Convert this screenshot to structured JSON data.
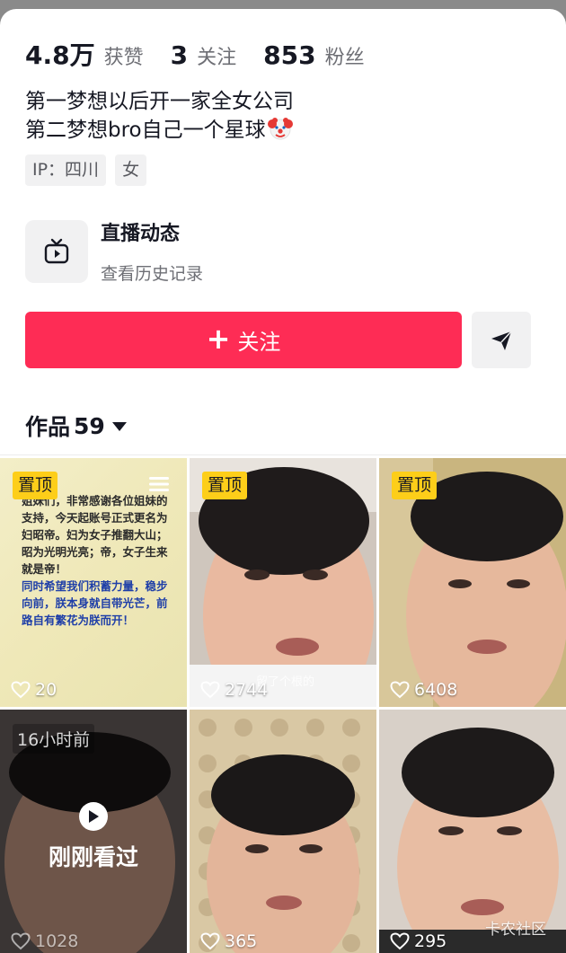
{
  "stats": [
    {
      "value": "4.8万",
      "label": "获赞"
    },
    {
      "value": "3",
      "label": "关注"
    },
    {
      "value": "853",
      "label": "粉丝"
    }
  ],
  "bio": {
    "line1": "第一梦想以后开一家全女公司",
    "line2": "第二梦想bro自己一个星球",
    "emoji_icon": "clown-face-icon"
  },
  "tags": [
    "IP：四川",
    "女"
  ],
  "live": {
    "icon": "tv-icon",
    "title": "直播动态",
    "subtitle": "查看历史记录"
  },
  "actions": {
    "follow_label": "关注",
    "follow_color": "#fe2c55",
    "share_icon": "send-icon"
  },
  "works": {
    "label": "作品",
    "count": "59"
  },
  "grid": {
    "pin_label": "置顶",
    "items": [
      {
        "likes": "20",
        "pinned": true,
        "doc_lines": [
          "姐妹们，非常感谢各位姐妹的支持，今天起账号正式更名为妇昭帝。妇为女子推翻大山；昭为光明光亮；帝，女子生来就是帝！",
          "同时希望我们积蓄力量，稳步向前，朕本身就自带光芒，前路自有繁花为朕而开！"
        ]
      },
      {
        "likes": "2744",
        "pinned": true,
        "caption": "留了个根的"
      },
      {
        "likes": "6408",
        "pinned": true
      },
      {
        "likes": "1028",
        "time": "16小时前",
        "watched": "刚刚看过"
      },
      {
        "likes": "365"
      },
      {
        "likes": "295"
      }
    ]
  },
  "watermark": "卡农社区"
}
